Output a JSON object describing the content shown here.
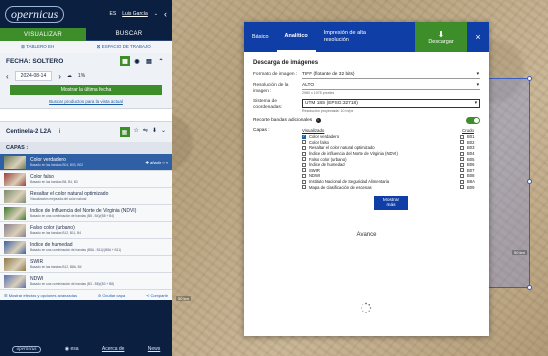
{
  "header": {
    "logo_text": "opernicus",
    "lang": "ES",
    "user": "Luis García",
    "user_caret": "⌄",
    "collapse": "‹"
  },
  "main_tabs": [
    "VISUALIZAR",
    "BUSCAR"
  ],
  "sub_tabs": [
    "TABLERO EH",
    "ESPACIO DE TRABAJO"
  ],
  "fecha": {
    "label": "FECHA: SOLTERO",
    "date": "2024-08-14",
    "cloud": "1%",
    "prev": "‹",
    "next": "›"
  },
  "show_latest_button": "Mostrar la última fecha",
  "search_link": "Buscar productos para la vista actual",
  "default_select": "Por defecto",
  "collection": {
    "title": "Centinela-2 L2A",
    "info": "i"
  },
  "capas_heading": "CAPAS :",
  "sidebar_layers": [
    {
      "title": "Color verdadero",
      "desc": "Basado en las bandas B04, B03, B02",
      "actions": "✚ añadir  ‹›  ▿",
      "active": true,
      "thumb": "#6a7b5a"
    },
    {
      "title": "Color falso",
      "desc": "Basado en las bandas B8, B4, B3",
      "active": false,
      "thumb": "#9c3f3a"
    },
    {
      "title": "Resaltar el color natural optimizado",
      "desc": "Visualización mejorada del color natural",
      "active": false,
      "thumb": "#7b8a6a"
    },
    {
      "title": "Índice de Influencia del Norte de Virginia (NDVI)",
      "desc": "Basado en una combinación de bandas (B8 - B4)/(B8 + B4)",
      "active": false,
      "thumb": "#3f7a2c"
    },
    {
      "title": "Falso color (urbano)",
      "desc": "Basado en las bandas B12, B11, B4",
      "active": false,
      "thumb": "#8a7d8c"
    },
    {
      "title": "Índice de humedad",
      "desc": "Basado en una combinación de bandas (B8A - B11)/(B8A + B11)",
      "active": false,
      "thumb": "#3b5fa3"
    },
    {
      "title": "SWIR",
      "desc": "Basado en las bandas B12, B8A, B4",
      "active": false,
      "thumb": "#8c7a48"
    },
    {
      "title": "NDWI",
      "desc": "Basado en una combinación de bandas (B3 - B8)/(B3 + B8)",
      "active": false,
      "thumb": "#5a6fb0"
    }
  ],
  "bottom_links": [
    "Mostrar efectos y opciones avanzadas",
    "Ocultar capa",
    "Compartir"
  ],
  "footer": {
    "logo": "opernicus",
    "esa": "esa",
    "about": "Acerca de",
    "news": "News"
  },
  "modal": {
    "tabs": [
      "Básico",
      "Analítico",
      "Impresión de alta resolución"
    ],
    "active_tab": "Analítico",
    "download_label": "Descargar",
    "download_icon": "⬇",
    "close_icon": "×",
    "section_title": "Descarga de imágenes",
    "image_format_label": "Formato de imagen :",
    "image_format_value": "TIFF (flotante de 32 bits)",
    "resolution_label": "Resolución de la imagen :",
    "resolution_value": "ALTO",
    "resolution_hint": "2980 x 1975 píxeles",
    "crs_label": "Sistema de coordenadas:",
    "crs_value": "UTM 18S (EPSG:32718)",
    "crs_hint": "Resolución proyectada: 10 m/px",
    "extra_bands_label": "Recorte bandas adicionales",
    "extra_bands_info": "i",
    "capas_label": "Capas :",
    "col_visualized": "Visualizado",
    "col_raw": "Crudo",
    "layers": [
      {
        "name": "Color verdadero",
        "checked": true,
        "raw": "B01"
      },
      {
        "name": "Color falso",
        "checked": false,
        "raw": "B02"
      },
      {
        "name": "Resaltar el color natural optimizado",
        "checked": false,
        "raw": "B03"
      },
      {
        "name": "Índice de influencia del Norte de Virginia (NDVI)",
        "checked": false,
        "raw": "B04"
      },
      {
        "name": "Falso color (urbano)",
        "checked": false,
        "raw": "B05"
      },
      {
        "name": "Índice de humedad",
        "checked": false,
        "raw": "B06"
      },
      {
        "name": "SWIR",
        "checked": false,
        "raw": "B07"
      },
      {
        "name": "NDWI",
        "checked": false,
        "raw": "B08"
      },
      {
        "name": "Instituto Nacional de Seguridad Alimentaria",
        "checked": false,
        "raw": "B8A"
      },
      {
        "name": "Mapa de clasificación de escenas",
        "checked": false,
        "raw": "B09"
      }
    ],
    "show_more": "Mostrar más",
    "progress_label": "Avance"
  },
  "map_tags": [
    "50 km",
    "50 km"
  ]
}
